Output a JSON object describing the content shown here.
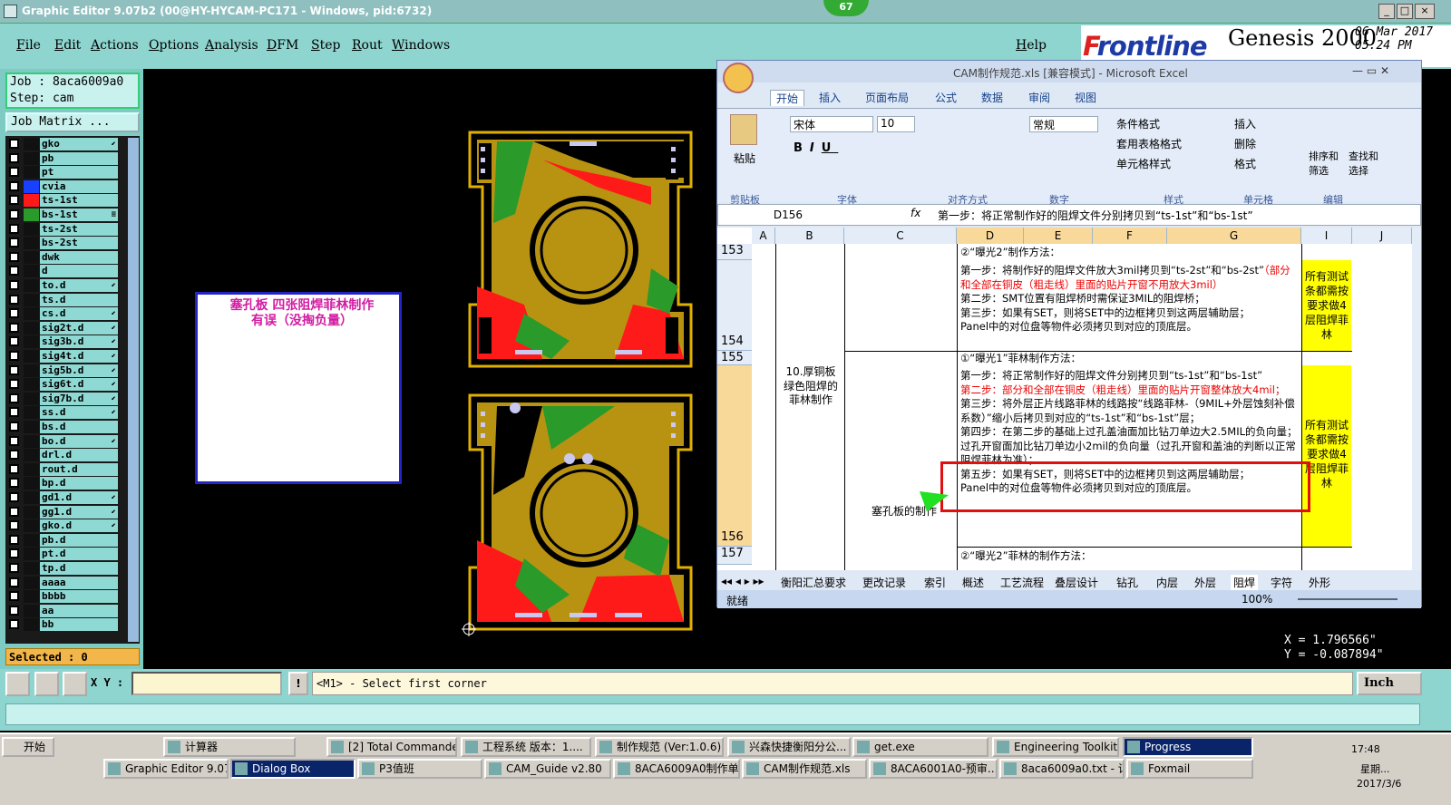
{
  "ge": {
    "title": "Graphic Editor 9.07b2 (00@HY-HYCAM-PC171 - Windows, pid:6732)",
    "badge": "67",
    "menus": [
      "File",
      "Edit",
      "Actions",
      "Options",
      "Analysis",
      "DFM",
      "Step",
      "Rout",
      "Windows"
    ],
    "help": "Help",
    "brand": {
      "logo_f": "F",
      "logo_rest": "rontline",
      "product": "Genesis 2000",
      "date": "06 Mar 2017",
      "time": "05:24 PM"
    },
    "job": "Job : 8aca6009a0",
    "step": "Step: cam",
    "job_matrix": "Job Matrix ...",
    "layers": [
      {
        "name": "gko",
        "color": "#111",
        "mark": "⬋"
      },
      {
        "name": "pb",
        "color": "#111",
        "mark": ""
      },
      {
        "name": "pt",
        "color": "#111",
        "mark": ""
      },
      {
        "name": "cvia",
        "color": "#1740ff",
        "mark": ""
      },
      {
        "name": "ts-1st",
        "color": "#ff1a1a",
        "mark": ""
      },
      {
        "name": "bs-1st",
        "color": "#2a9a2a",
        "mark": "≡"
      },
      {
        "name": "ts-2st",
        "color": "#111",
        "mark": ""
      },
      {
        "name": "bs-2st",
        "color": "#111",
        "mark": ""
      },
      {
        "name": "dwk",
        "color": "#111",
        "mark": ""
      },
      {
        "name": "d",
        "color": "#111",
        "mark": ""
      },
      {
        "name": "to.d",
        "color": "#111",
        "mark": "⬋"
      },
      {
        "name": "ts.d",
        "color": "#111",
        "mark": ""
      },
      {
        "name": "cs.d",
        "color": "#111",
        "mark": "⬋"
      },
      {
        "name": "sig2t.d",
        "color": "#111",
        "mark": "⬋"
      },
      {
        "name": "sig3b.d",
        "color": "#111",
        "mark": "⬋"
      },
      {
        "name": "sig4t.d",
        "color": "#111",
        "mark": "⬋"
      },
      {
        "name": "sig5b.d",
        "color": "#111",
        "mark": "⬋"
      },
      {
        "name": "sig6t.d",
        "color": "#111",
        "mark": "⬋"
      },
      {
        "name": "sig7b.d",
        "color": "#111",
        "mark": "⬋"
      },
      {
        "name": "ss.d",
        "color": "#111",
        "mark": "⬋"
      },
      {
        "name": "bs.d",
        "color": "#111",
        "mark": ""
      },
      {
        "name": "bo.d",
        "color": "#111",
        "mark": "⬋"
      },
      {
        "name": "drl.d",
        "color": "#111",
        "mark": ""
      },
      {
        "name": "rout.d",
        "color": "#111",
        "mark": ""
      },
      {
        "name": "bp.d",
        "color": "#111",
        "mark": ""
      },
      {
        "name": "gd1.d",
        "color": "#111",
        "mark": "⬋"
      },
      {
        "name": "gg1.d",
        "color": "#111",
        "mark": "⬋"
      },
      {
        "name": "gko.d",
        "color": "#111",
        "mark": "⬋"
      },
      {
        "name": "pb.d",
        "color": "#111",
        "mark": ""
      },
      {
        "name": "pt.d",
        "color": "#111",
        "mark": ""
      },
      {
        "name": "tp.d",
        "color": "#111",
        "mark": ""
      },
      {
        "name": "aaaa",
        "color": "#111",
        "mark": ""
      },
      {
        "name": "bbbb",
        "color": "#111",
        "mark": ""
      },
      {
        "name": "aa",
        "color": "#111",
        "mark": ""
      },
      {
        "name": "bb",
        "color": "#111",
        "mark": ""
      }
    ],
    "selected": "Selected : 0",
    "xy_label": "X Y :",
    "xy_value": "",
    "message": "<M1> - Select first corner",
    "units": "Inch",
    "coord_x": "X = 1.796566\"",
    "coord_y": "Y = -0.087894\"",
    "note_line1": "塞孔板   四张阻焊菲林制作",
    "note_line2": "有误（没掏负量）"
  },
  "excel": {
    "title": "CAM制作规范.xls  [兼容模式] - Microsoft Excel",
    "tabs": [
      "开始",
      "插入",
      "页面布局",
      "公式",
      "数据",
      "审阅",
      "视图"
    ],
    "ribbon": {
      "paste": "粘贴",
      "font_name": "宋体",
      "font_size": "10",
      "number_format": "常规",
      "cond_format": "条件格式",
      "table_format": "套用表格格式",
      "cell_style": "单元格样式",
      "insert": "插入",
      "delete": "删除",
      "format": "格式",
      "sort_filter": "排序和筛选",
      "find_select": "查找和选择",
      "groups": [
        "剪贴板",
        "字体",
        "对齐方式",
        "数字",
        "样式",
        "单元格",
        "编辑"
      ]
    },
    "name_box": "D156",
    "fx": "fx",
    "formula": "第一步：将正常制作好的阻焊文件分别拷贝到“ts-1st”和“bs-1st”",
    "columns": [
      "A",
      "B",
      "C",
      "D",
      "E",
      "F",
      "G",
      "I",
      "J"
    ],
    "rows": [
      "153",
      "154",
      "155",
      "156",
      "157"
    ],
    "r153": "②“曝光2”制作方法：",
    "r154_a": "第一步：将制作好的阻焊文件放大3mil拷贝到“ts-2st”和“bs-2st”",
    "r154_b": "（部分和全部在铜皮（粗走线）里面的贴片开窗不用放大3mil）",
    "r154_c": "第二步：SMT位置有阻焊桥时需保证3MIL的阻焊桥；",
    "r154_d": "第三步：如果有SET，则将SET中的边框拷贝到这两层辅助层；",
    "r154_e": "Panel中的对位盘等物件必须拷贝到对应的顶底层。",
    "i154": "所有测试条都需按要求做4层阻焊菲林",
    "b_section": "10.厚铜板绿色阻焊的菲林制作",
    "c_section": "塞孔板的制作",
    "r155": "①“曝光1”菲林制作方法：",
    "r156_a": "第一步：将正常制作好的阻焊文件分别拷贝到“ts-1st”和“bs-1st”",
    "r156_b": "第二步：部分和全部在铜皮（粗走线）里面的贴片开窗整体放大4mil；",
    "r156_c": "第三步：将外层正片线路菲林的线路按“线路菲林-（9MIL+外层蚀刻补偿系数）”缩小后拷贝到对应的“ts-1st”和“bs-1st”层；",
    "r156_d": "第四步：在第二步的基础上过孔盖油面加比钻刀单边大2.5MIL的负向量；过孔开窗面加比钻刀单边小2mil的负向量（过孔开窗和盖油的判断以正常阻焊菲林为准）；",
    "r156_e": "第五步：如果有SET，则将SET中的边框拷贝到这两层辅助层；",
    "r156_f": "Panel中的对位盘等物件必须拷贝到对应的顶底层。",
    "i156": "所有测试条都需按要求做4层阻焊菲林",
    "r157": "②“曝光2”菲林的制作方法：",
    "sheets": [
      "衡阳汇总要求",
      "更改记录",
      "索引",
      "概述",
      "工艺流程",
      "叠层设计",
      "钻孔",
      "内层",
      "外层",
      "阻焊",
      "字符",
      "外形"
    ],
    "status": "就绪",
    "zoom": "100%"
  },
  "taskbar": {
    "start": "开始",
    "row1": [
      {
        "label": "计算器",
        "active": false
      },
      {
        "label": "[2] Total Commander ...",
        "active": false
      },
      {
        "label": "工程系统  版本：1....",
        "active": false
      },
      {
        "label": "制作规范 (Ver:1.0.6)",
        "active": false
      },
      {
        "label": "兴森快捷衡阳分公...",
        "active": false
      },
      {
        "label": "get.exe",
        "active": false
      },
      {
        "label": "Engineering Toolkit 9....",
        "active": false
      },
      {
        "label": "Progress",
        "active": true
      }
    ],
    "row2": [
      {
        "label": "Graphic Editor 9.07b...",
        "active": false
      },
      {
        "label": "Dialog Box",
        "active": true
      },
      {
        "label": "P3值班",
        "active": false
      },
      {
        "label": "CAM_Guide v2.80",
        "active": false
      },
      {
        "label": "8ACA6009A0制作单...",
        "active": false
      },
      {
        "label": "CAM制作规范.xls",
        "active": false
      },
      {
        "label": "8ACA6001A0-预审...",
        "active": false
      },
      {
        "label": "8aca6009a0.txt - 记...",
        "active": false
      },
      {
        "label": "Foxmail",
        "active": false
      }
    ],
    "time": "17:48",
    "weekday": "星期...",
    "date": "2017/3/6"
  }
}
